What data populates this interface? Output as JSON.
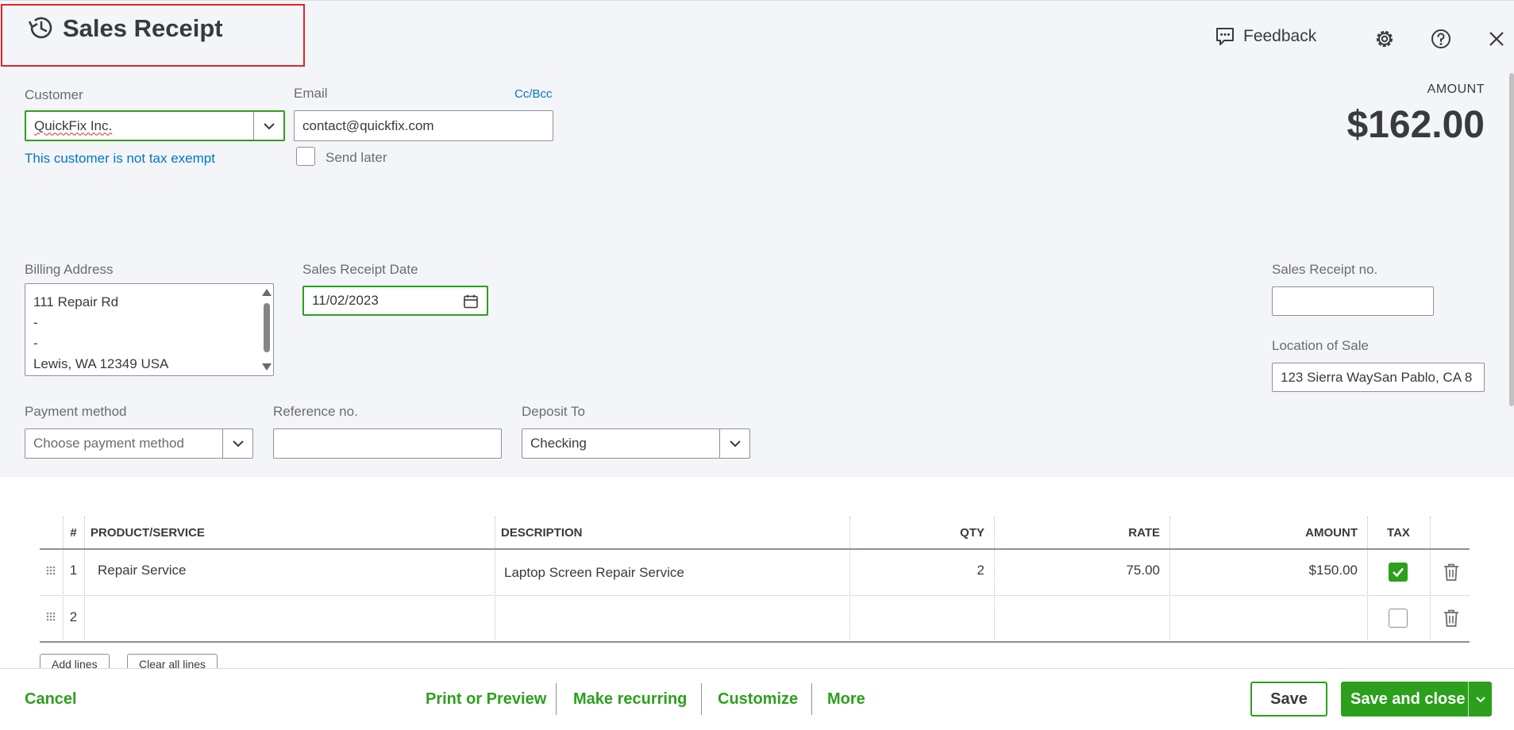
{
  "header": {
    "title": "Sales Receipt",
    "feedback_label": "Feedback"
  },
  "customer": {
    "label": "Customer",
    "value": "QuickFix Inc.",
    "tax_note": "This customer is not tax exempt"
  },
  "email": {
    "label": "Email",
    "cc_bcc": "Cc/Bcc",
    "value": "contact@quickfix.com",
    "send_later_label": "Send later"
  },
  "amount": {
    "label": "AMOUNT",
    "value": "$162.00"
  },
  "billing": {
    "label": "Billing Address",
    "lines": [
      "111 Repair Rd",
      "-",
      "-",
      "Lewis, WA  12349 USA"
    ]
  },
  "receipt_date": {
    "label": "Sales Receipt Date",
    "value": "11/02/2023"
  },
  "receipt_no": {
    "label": "Sales Receipt no.",
    "value": ""
  },
  "location": {
    "label": "Location of Sale",
    "value": "123 Sierra WaySan Pablo, CA  8"
  },
  "payment": {
    "label": "Payment method",
    "placeholder": "Choose payment method"
  },
  "reference": {
    "label": "Reference no.",
    "value": ""
  },
  "deposit": {
    "label": "Deposit To",
    "value": "Checking"
  },
  "table": {
    "headers": {
      "num": "#",
      "product": "PRODUCT/SERVICE",
      "description": "DESCRIPTION",
      "qty": "QTY",
      "rate": "RATE",
      "amount": "AMOUNT",
      "tax": "TAX"
    },
    "rows": [
      {
        "num": "1",
        "product": "Repair Service",
        "description": "Laptop Screen Repair Service",
        "qty": "2",
        "rate": "75.00",
        "amount": "$150.00",
        "tax": true
      },
      {
        "num": "2",
        "product": "",
        "description": "",
        "qty": "",
        "rate": "",
        "amount": "",
        "tax": false
      }
    ],
    "add_lines": "Add lines",
    "clear_lines": "Clear all lines"
  },
  "footer": {
    "cancel": "Cancel",
    "print_preview": "Print or Preview",
    "make_recurring": "Make recurring",
    "customize": "Customize",
    "more": "More",
    "save": "Save",
    "save_and_close": "Save and close"
  },
  "colors": {
    "accent_green": "#2ca01c",
    "link_blue": "#0077c5",
    "highlight_red": "#e0242a"
  }
}
